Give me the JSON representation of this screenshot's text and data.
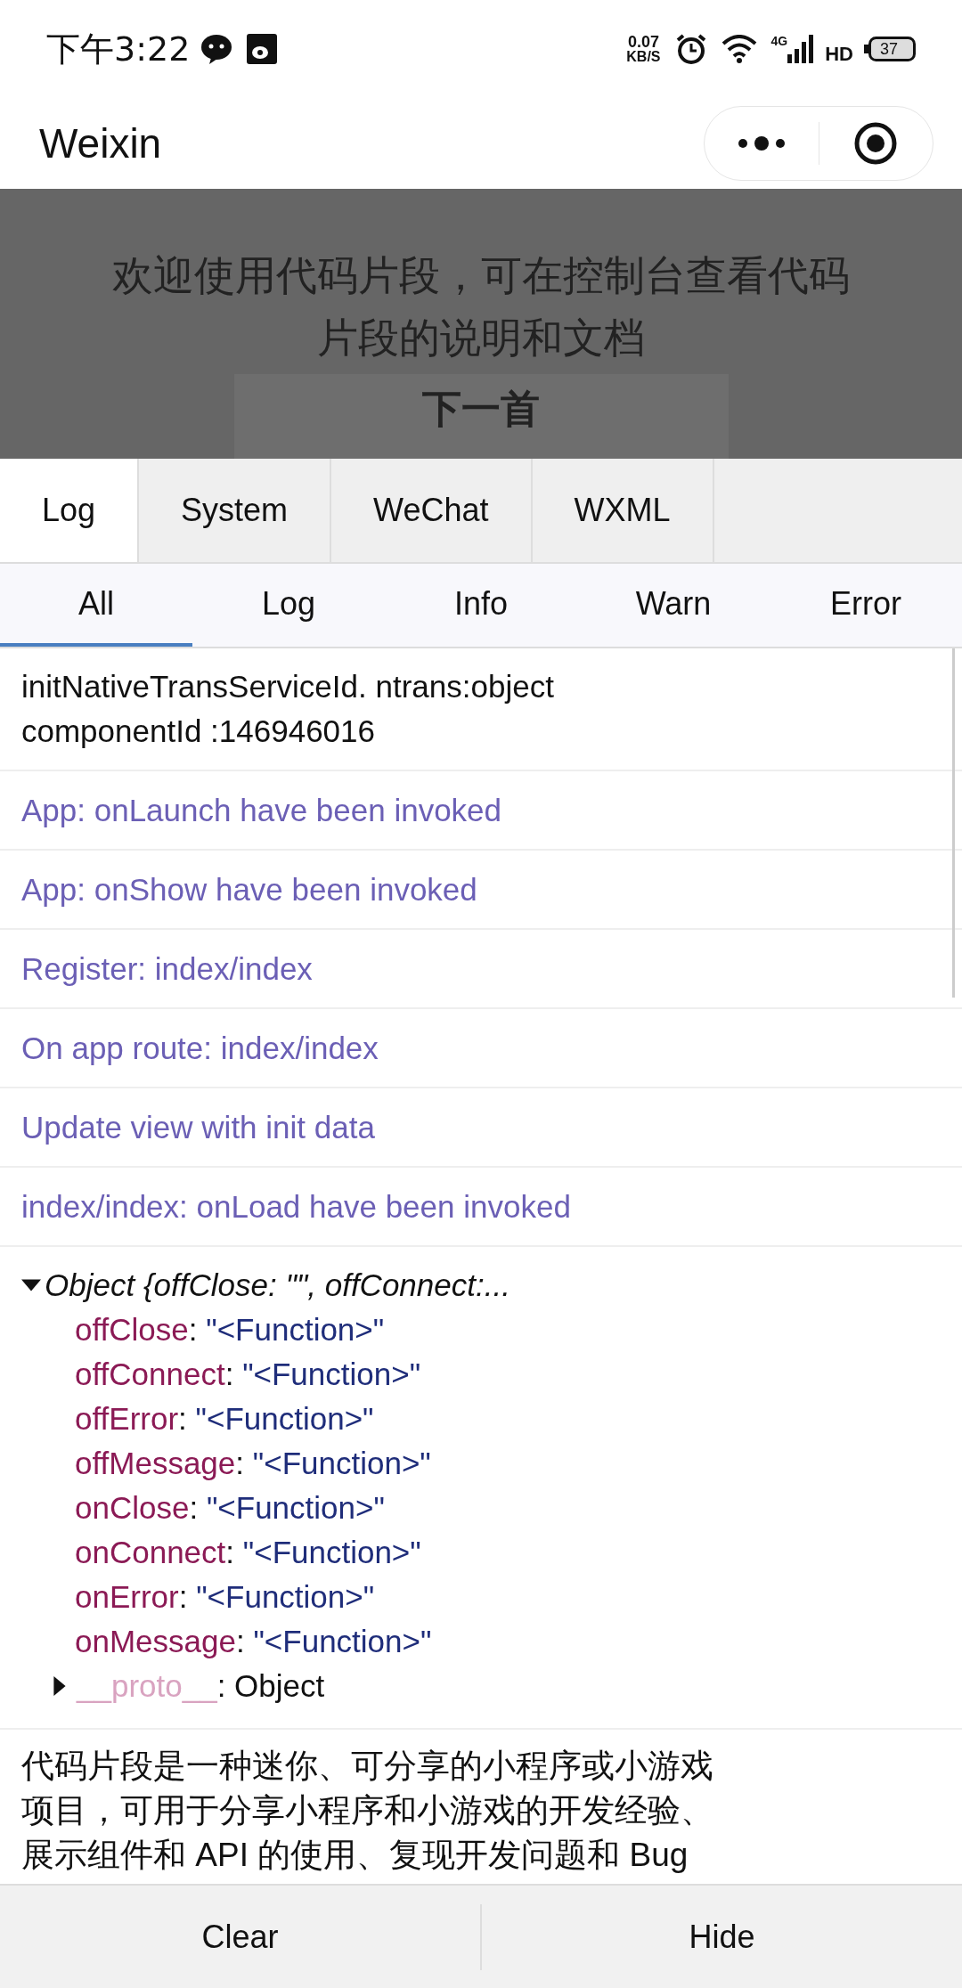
{
  "status_bar": {
    "time": "下午3:22",
    "speed_value": "0.07",
    "speed_unit": "KB/S",
    "network": "4G",
    "hd": "HD",
    "battery": "37"
  },
  "nav_bar": {
    "title": "Weixin"
  },
  "page": {
    "message": "欢迎使用代码片段，可在控制台查看代码片段的说明和文档",
    "button": "下一首"
  },
  "tabs": [
    {
      "label": "Log",
      "selected": true
    },
    {
      "label": "System",
      "selected": false
    },
    {
      "label": "WeChat",
      "selected": false
    },
    {
      "label": "WXML",
      "selected": false
    }
  ],
  "filters": [
    {
      "label": "All",
      "selected": true
    },
    {
      "label": "Log",
      "selected": false
    },
    {
      "label": "Info",
      "selected": false
    },
    {
      "label": "Warn",
      "selected": false
    },
    {
      "label": "Error",
      "selected": false
    }
  ],
  "logs": [
    {
      "kind": "log",
      "text": "initNativeTransServiceId. ntrans:object componentId :146946016"
    },
    {
      "kind": "info",
      "text": "App: onLaunch have been invoked"
    },
    {
      "kind": "info",
      "text": "App: onShow have been invoked"
    },
    {
      "kind": "info",
      "text": "Register: index/index"
    },
    {
      "kind": "info",
      "text": "On app route: index/index"
    },
    {
      "kind": "info",
      "text": "Update view with init data"
    },
    {
      "kind": "info",
      "text": "index/index: onLoad have been invoked"
    }
  ],
  "object": {
    "summary": "Object {offClose: \"\", offConnect:...",
    "expanded": true,
    "separator": ":",
    "properties": [
      {
        "key": "offClose",
        "value": "\"<Function>\""
      },
      {
        "key": "offConnect",
        "value": "\"<Function>\""
      },
      {
        "key": "offError",
        "value": "\"<Function>\""
      },
      {
        "key": "offMessage",
        "value": "\"<Function>\""
      },
      {
        "key": "onClose",
        "value": "\"<Function>\""
      },
      {
        "key": "onConnect",
        "value": "\"<Function>\""
      },
      {
        "key": "onError",
        "value": "\"<Function>\""
      },
      {
        "key": "onMessage",
        "value": "\"<Function>\""
      }
    ],
    "proto": {
      "key": "__proto__",
      "value": "Object",
      "expanded": false
    }
  },
  "description": "代码片段是一种迷你、可分享的小程序或小游戏项目，可用于分享小程序和小游戏的开发经验、展示组件和 API 的使用、复现开发问题和 Bug",
  "bottom_buttons": [
    "Clear",
    "Hide"
  ]
}
